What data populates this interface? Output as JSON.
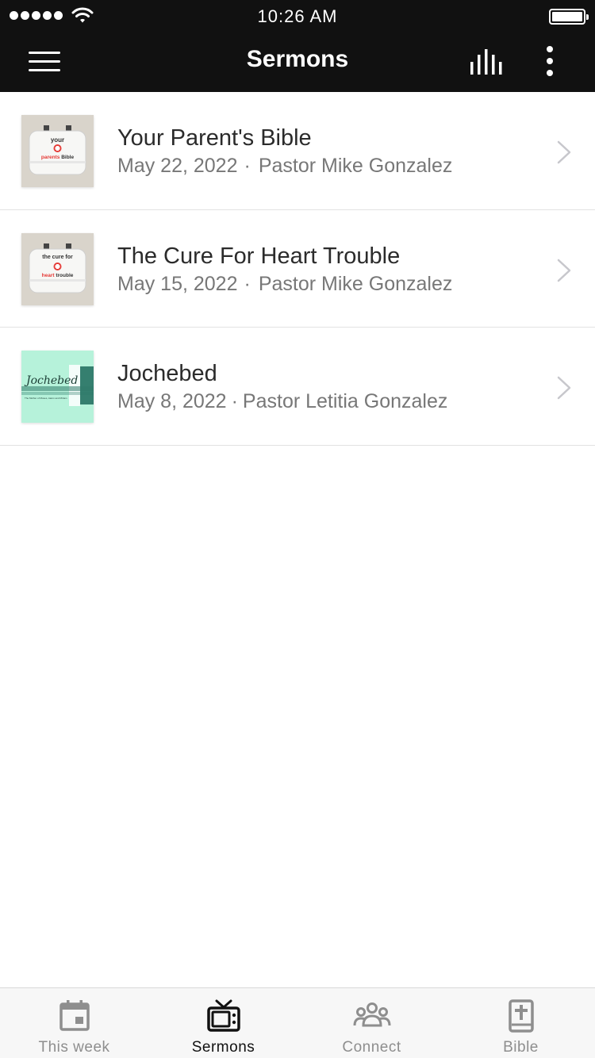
{
  "status_bar": {
    "time": "10:26 AM"
  },
  "nav": {
    "title": "Sermons"
  },
  "sermons": [
    {
      "title": "Your Parent's Bible",
      "date": "May 22, 2022",
      "speaker": "Pastor Mike Gonzalez",
      "thumb_line1": "your",
      "thumb_line2a": "parents",
      "thumb_line2b": "Bible"
    },
    {
      "title": "The Cure For Heart Trouble",
      "date": "May 15, 2022",
      "speaker": "Pastor Mike Gonzalez",
      "thumb_line1": "the cure for",
      "thumb_line2a": "heart",
      "thumb_line2b": "trouble"
    },
    {
      "title": "Jochebed",
      "date": "May 8, 2022",
      "speaker": "Pastor Letitia Gonzalez",
      "thumb_title": "Jochebed",
      "thumb_subtitle": "The Mother of Moses, Aaron and Miriam"
    }
  ],
  "tabs": [
    {
      "label": "This week",
      "icon": "calendar-icon"
    },
    {
      "label": "Sermons",
      "icon": "tv-icon",
      "active": true
    },
    {
      "label": "Connect",
      "icon": "people-icon"
    },
    {
      "label": "Bible",
      "icon": "bible-icon"
    }
  ],
  "colors": {
    "header_bg": "#111111",
    "thumb_red": "#e53935",
    "thumb_mint": "#b6f2da",
    "inactive_tab": "#8e8e8e"
  }
}
